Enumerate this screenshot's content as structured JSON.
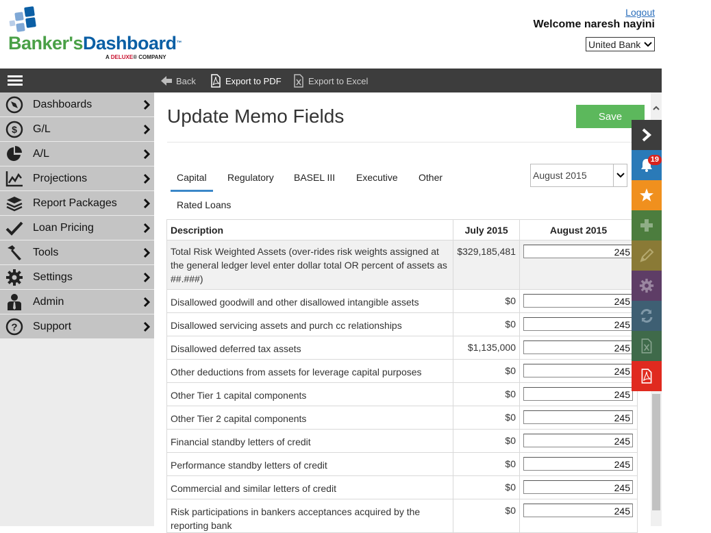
{
  "header": {
    "logo": {
      "brand_part1": "Banker's",
      "brand_part2": "Dashboard",
      "tm": "™",
      "sub_prefix": "A ",
      "sub_brand": "DELUXE",
      "sub_suffix": "® COMPANY"
    },
    "logout_label": "Logout",
    "welcome_text": "Welcome  naresh nayini",
    "bank_selected": "United Bank"
  },
  "toolbar": {
    "back_label": "Back",
    "export_pdf_label": "Export to PDF",
    "export_excel_label": "Export to Excel"
  },
  "sidebar": {
    "items": [
      {
        "label": "Dashboards",
        "icon": "compass-icon"
      },
      {
        "label": "G/L",
        "icon": "dollar-icon"
      },
      {
        "label": "A/L",
        "icon": "pie-chart-icon"
      },
      {
        "label": "Projections",
        "icon": "line-chart-icon"
      },
      {
        "label": "Report Packages",
        "icon": "layers-icon"
      },
      {
        "label": "Loan Pricing",
        "icon": "check-icon"
      },
      {
        "label": "Tools",
        "icon": "hammer-icon"
      },
      {
        "label": "Settings",
        "icon": "gear-icon"
      },
      {
        "label": "Admin",
        "icon": "user-icon"
      },
      {
        "label": "Support",
        "icon": "question-icon"
      }
    ]
  },
  "main": {
    "title": "Update Memo Fields",
    "save_label": "Save",
    "tabs": [
      "Capital",
      "Regulatory",
      "BASEL III",
      "Executive",
      "Other",
      "Rated Loans"
    ],
    "active_tab": "Capital",
    "month_selected": "August 2015",
    "table": {
      "headers": [
        "Description",
        "July 2015",
        "August 2015"
      ],
      "rows": [
        {
          "description": "Total Risk Weighted Assets (over-rides risk weights assigned at the general ledger level enter dollar total OR percent of assets as ##.###)",
          "july": "$329,185,481",
          "august": "245"
        },
        {
          "description": "Disallowed goodwill and other disallowed intangible assets",
          "july": "$0",
          "august": "245"
        },
        {
          "description": "Disallowed servicing assets and purch cc relationships",
          "july": "$0",
          "august": "245"
        },
        {
          "description": "Disallowed deferred tax assets",
          "july": "$1,135,000",
          "august": "245"
        },
        {
          "description": "Other deductions from assets for leverage capital purposes",
          "july": "$0",
          "august": "245"
        },
        {
          "description": "Other Tier 1 capital components",
          "july": "$0",
          "august": "245"
        },
        {
          "description": "Other Tier 2 capital components",
          "july": "$0",
          "august": "245"
        },
        {
          "description": "Financial standby letters of credit",
          "july": "$0",
          "august": "245"
        },
        {
          "description": "Performance standby letters of credit",
          "july": "$0",
          "august": "245"
        },
        {
          "description": "Commercial and similar letters of credit",
          "july": "$0",
          "august": "245"
        },
        {
          "description": "Risk participations in bankers acceptances acquired by the reporting bank",
          "july": "$0",
          "august": "245"
        }
      ]
    }
  },
  "dock": {
    "notification_count": "19",
    "buttons": [
      {
        "name": "collapse-dock-button",
        "icon": "chevron-right-icon",
        "color": "#3d3d3d"
      },
      {
        "name": "notifications-button",
        "icon": "bell-icon",
        "color": "#2a7ab8"
      },
      {
        "name": "favorites-button",
        "icon": "star-icon",
        "color": "#f0901e"
      },
      {
        "name": "add-button",
        "icon": "plus-icon",
        "color": "#4c7d3e"
      },
      {
        "name": "edit-button",
        "icon": "pencil-icon",
        "color": "#8a7a36"
      },
      {
        "name": "settings-button",
        "icon": "gear-icon",
        "color": "#5e3d66"
      },
      {
        "name": "refresh-button",
        "icon": "refresh-icon",
        "color": "#3e5f73"
      },
      {
        "name": "excel-button",
        "icon": "excel-icon",
        "color": "#3f6a4a"
      },
      {
        "name": "pdf-button",
        "icon": "pdf-icon",
        "color": "#e02a1f"
      }
    ]
  },
  "colors": {
    "toolbar_bg": "#3d3d3d",
    "sidebar_item_bg": "#c4c4c4",
    "save_green": "#5cb85c",
    "tab_underline": "#3a87c8",
    "brand_green": "#4aa047",
    "brand_blue": "#0b5fa5"
  }
}
